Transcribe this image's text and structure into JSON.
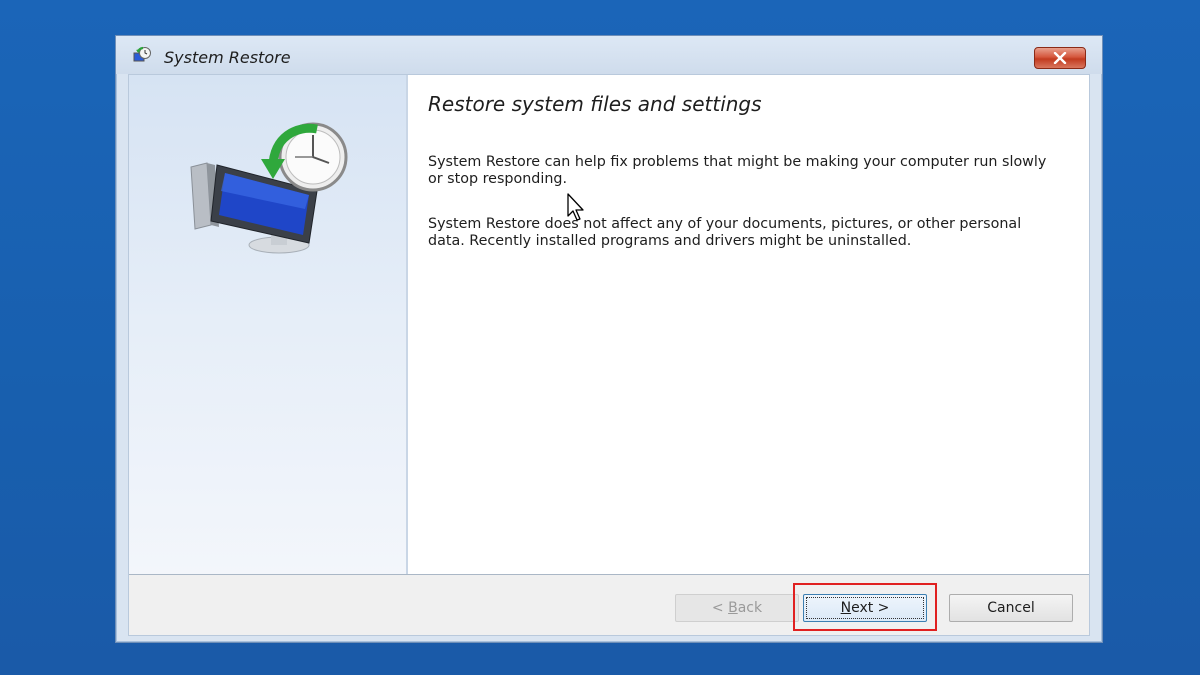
{
  "window": {
    "title": "System Restore",
    "close_icon": "close-icon"
  },
  "main": {
    "heading": "Restore system files and settings",
    "paragraph1": "System Restore can help fix problems that might be making your computer run slowly or stop responding.",
    "paragraph2": "System Restore does not affect any of your documents, pictures, or other personal data. Recently installed programs and drivers might be uninstalled."
  },
  "footer": {
    "back": {
      "prefix": "< ",
      "mnemonic": "B",
      "rest": "ack",
      "enabled": false
    },
    "next": {
      "mnemonic": "N",
      "rest": "ext >",
      "enabled": true,
      "highlighted": true
    },
    "cancel": {
      "label": "Cancel",
      "enabled": true
    }
  },
  "colors": {
    "desktop": "#1b65b8",
    "highlight": "#e02020",
    "close_button": "#c23b20"
  },
  "icons": {
    "title": "system-restore-icon",
    "hero": "computer-clock-restore-icon",
    "cursor": "mouse-pointer-icon"
  }
}
